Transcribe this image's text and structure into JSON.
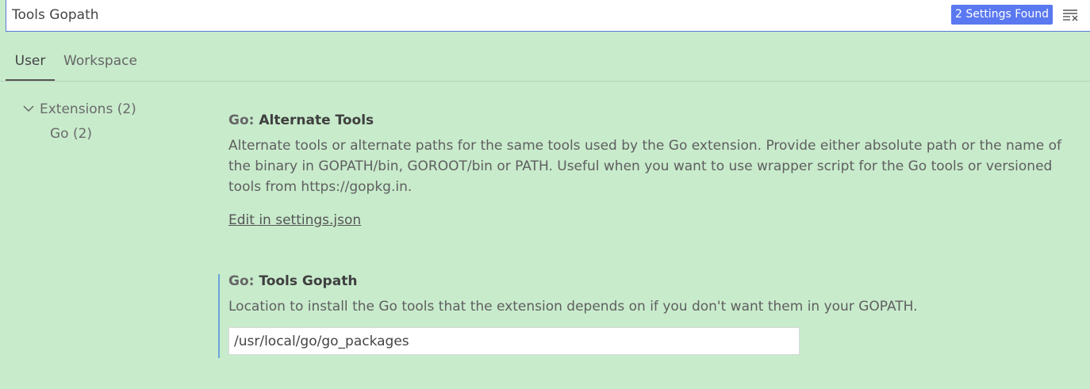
{
  "search": {
    "value": "Tools Gopath",
    "results_badge": "2 Settings Found",
    "clear_icon": "clear-filter-icon"
  },
  "tabs": [
    {
      "label": "User",
      "active": true
    },
    {
      "label": "Workspace",
      "active": false
    }
  ],
  "toc": {
    "extensions_label": "Extensions (2)",
    "go_label": "Go (2)",
    "chevron_icon": "chevron-down-icon"
  },
  "settings": [
    {
      "category": "Go: ",
      "name": "Alternate Tools",
      "description": "Alternate tools or alternate paths for the same tools used by the Go extension. Provide either absolute path or the name of the binary in GOPATH/bin, GOROOT/bin or PATH. Useful when you want to use wrapper script for the Go tools or versioned tools from https://gopkg.in.",
      "link": "Edit in settings.json"
    },
    {
      "category": "Go: ",
      "name": "Tools Gopath",
      "description": "Location to install the Go tools that the extension depends on if you don't want them in your GOPATH.",
      "value": "/usr/local/go/go_packages"
    }
  ],
  "colors": {
    "background": "#c8ebcc",
    "badge": "#5a78f0",
    "focus_border": "#5a7bd6",
    "modified_indicator": "#6aa3d8"
  }
}
